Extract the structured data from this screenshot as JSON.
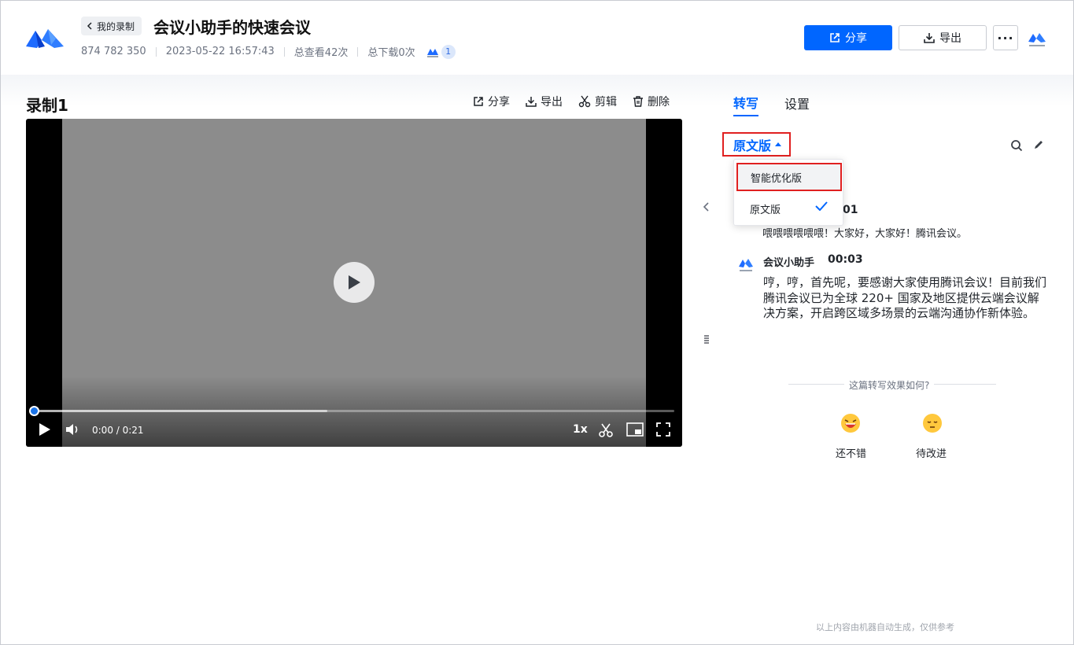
{
  "header": {
    "back_label": "我的录制",
    "title": "会议小助手的快速会议",
    "meeting_id": "874 782 350",
    "datetime": "2023-05-22 16:57:43",
    "views": "总查看42次",
    "downloads": "总下载0次",
    "participant_count": "1",
    "share_label": "分享",
    "export_label": "导出",
    "more_label": "···"
  },
  "recording": {
    "title": "录制1",
    "tools": {
      "share": "分享",
      "export": "导出",
      "edit": "剪辑",
      "delete": "删除"
    }
  },
  "player": {
    "time": "0:00 / 0:21",
    "speed": "1x",
    "progress_buffered_fraction": 0.458,
    "progress_played_fraction": 0.0
  },
  "panel": {
    "tabs": [
      "转写",
      "设置"
    ],
    "version_selected": "原文版",
    "dropdown": {
      "options": [
        "智能优化版",
        "原文版"
      ],
      "checked": "原文版"
    },
    "transcript": [
      {
        "time_partial": "01",
        "text": "喂喂喂喂喂喂！大家好，大家好！腾讯会议。"
      },
      {
        "speaker": "会议小助手",
        "time": "00:03",
        "text": "哼，哼，首先呢，要感谢大家使用腾讯会议！目前我们腾讯会议已为全球 220+ 国家及地区提供云端会议解决方案，开启跨区域多场景的云端沟通协作新体验。"
      }
    ],
    "feedback": {
      "question": "这篇转写效果如何?",
      "good": "还不错",
      "bad": "待改进"
    },
    "footer_note": "以上内容由机器自动生成，仅供参考"
  },
  "colors": {
    "accent": "#0066ff",
    "highlight_box": "#e02020"
  }
}
